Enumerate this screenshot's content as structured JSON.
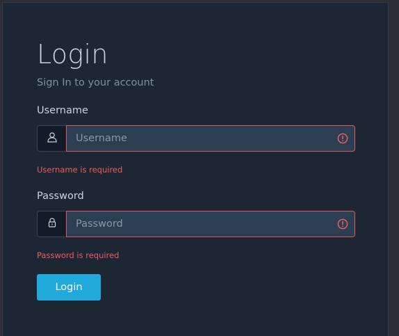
{
  "login": {
    "title": "Login",
    "subtitle": "Sign In to your account",
    "username": {
      "label": "Username",
      "placeholder": "Username",
      "value": "",
      "error": "Username is required",
      "icon": "user-icon"
    },
    "password": {
      "label": "Password",
      "placeholder": "Password",
      "value": "",
      "error": "Password is required",
      "icon": "lock-icon"
    },
    "submit_label": "Login"
  },
  "colors": {
    "background": "#1d2734",
    "input_bg": "#2c3e52",
    "error": "#ee5b60",
    "accent": "#22a9dc"
  }
}
